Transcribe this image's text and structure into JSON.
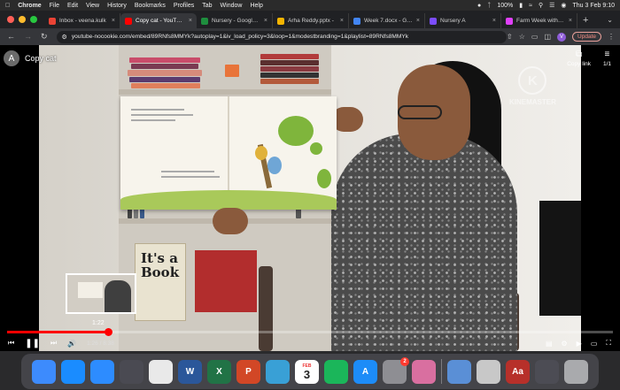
{
  "menubar": {
    "app_name": "Chrome",
    "items": [
      "File",
      "Edit",
      "View",
      "History",
      "Bookmarks",
      "Profiles",
      "Tab",
      "Window",
      "Help"
    ],
    "battery": "100%",
    "clock": "Thu 3 Feb  9:10"
  },
  "tabs": [
    {
      "label": "Inbox - veena.kulk",
      "icon": "gmail-icon",
      "color": "#ea4335",
      "active": false
    },
    {
      "label": "Copy cat - YouTube",
      "icon": "youtube-icon",
      "color": "#ff0000",
      "active": true
    },
    {
      "label": "Nursery - Google C",
      "icon": "classroom-icon",
      "color": "#1e8e3e",
      "active": false
    },
    {
      "label": "Arha Reddy.pptx -",
      "icon": "slides-icon",
      "color": "#f4b400",
      "active": false
    },
    {
      "label": "Week 7.docx - Goo",
      "icon": "docs-icon",
      "color": "#4285f4",
      "active": false
    },
    {
      "label": "Nursery A",
      "icon": "form-icon",
      "color": "#7c4dff",
      "active": false
    },
    {
      "label": "Farm Week with \"B",
      "icon": "sparkle-icon",
      "color": "#e040fb",
      "active": false
    }
  ],
  "address": {
    "url": "youtube-nocookie.com/embed/89RNfs8MMYk?autoplay=1&iv_load_policy=3&loop=1&modestbranding=1&playlist=89RNfs8MMYk",
    "profile_initial": "V",
    "update_label": "Update"
  },
  "video": {
    "channel_initial": "A",
    "title": "Copy cat",
    "copy_link_label": "Copy link",
    "playlist_position": "1/1",
    "watermark": "KINEMASTER",
    "book_title": "It's a Book",
    "preview_time": "1:22",
    "current_time": "1:26",
    "duration": "8:38",
    "time_separator": " / ",
    "progress_fraction": 0.166,
    "hover_fraction": 0.158
  },
  "dock": {
    "apps": [
      {
        "name": "finder-icon",
        "color": "#3d8bfd"
      },
      {
        "name": "safari-icon",
        "color": "#1a8cff"
      },
      {
        "name": "zoom-icon",
        "color": "#2d8cff"
      },
      {
        "name": "quicktime-icon",
        "color": "#4a4a52"
      },
      {
        "name": "chrome-icon",
        "color": "#e9e9e9"
      },
      {
        "name": "word-icon",
        "color": "#2b579a",
        "letter": "W"
      },
      {
        "name": "excel-icon",
        "color": "#217346",
        "letter": "X"
      },
      {
        "name": "powerpoint-icon",
        "color": "#d24726",
        "letter": "P"
      },
      {
        "name": "globe-icon",
        "color": "#39a0d6"
      },
      {
        "name": "calendar-icon",
        "month": "FEB",
        "day": "3"
      },
      {
        "name": "numbers-icon",
        "color": "#1bb65a"
      },
      {
        "name": "app-store-icon",
        "color": "#1d8cf8",
        "letter": "A"
      },
      {
        "name": "system-preferences-icon",
        "color": "#8e8e93",
        "badge": "2"
      },
      {
        "name": "launchpad-icon",
        "color": "#d96fa0"
      },
      {
        "name": "preview-icon",
        "color": "#5a8fd6"
      },
      {
        "name": "printer-icon",
        "color": "#c8c8c8"
      },
      {
        "name": "dictionary-icon",
        "color": "#b7302a",
        "letter": "Aa"
      },
      {
        "name": "screenshot-thumb-icon",
        "color": "#4c4c54"
      },
      {
        "name": "trash-icon",
        "color": "#a9aaad"
      }
    ]
  }
}
